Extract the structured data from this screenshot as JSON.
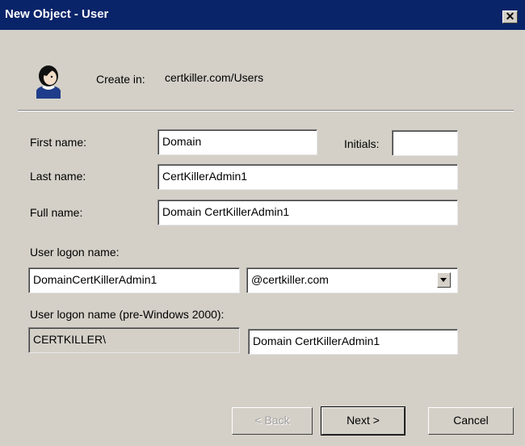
{
  "window": {
    "title": "New Object - User",
    "close_glyph": "✕"
  },
  "header": {
    "create_in_label": "Create in:",
    "create_in_value": "certkiller.com/Users"
  },
  "form": {
    "first_name": {
      "label": "First name:",
      "value": "Domain"
    },
    "initials": {
      "label": "Initials:",
      "value": ""
    },
    "last_name": {
      "label": "Last name:",
      "value": "CertKillerAdmin1"
    },
    "full_name": {
      "label": "Full name:",
      "value": "Domain  CertKillerAdmin1"
    },
    "user_logon": {
      "label": "User logon name:",
      "value": "DomainCertKillerAdmin1",
      "domain_selected": "@certkiller.com"
    },
    "pre2000": {
      "label": "User logon name (pre-Windows 2000):",
      "prefix": "CERTKILLER\\",
      "value": "Domain CertKillerAdmin1"
    }
  },
  "buttons": {
    "back": "< Back",
    "next": "Next >",
    "cancel": "Cancel"
  },
  "icons": {
    "user_icon": "user-icon",
    "close_icon": "close-icon",
    "dropdown_icon": "chevron-down-icon"
  },
  "colors": {
    "titlebar": "#0a246a",
    "dialog_bg": "#d4d0c8"
  }
}
